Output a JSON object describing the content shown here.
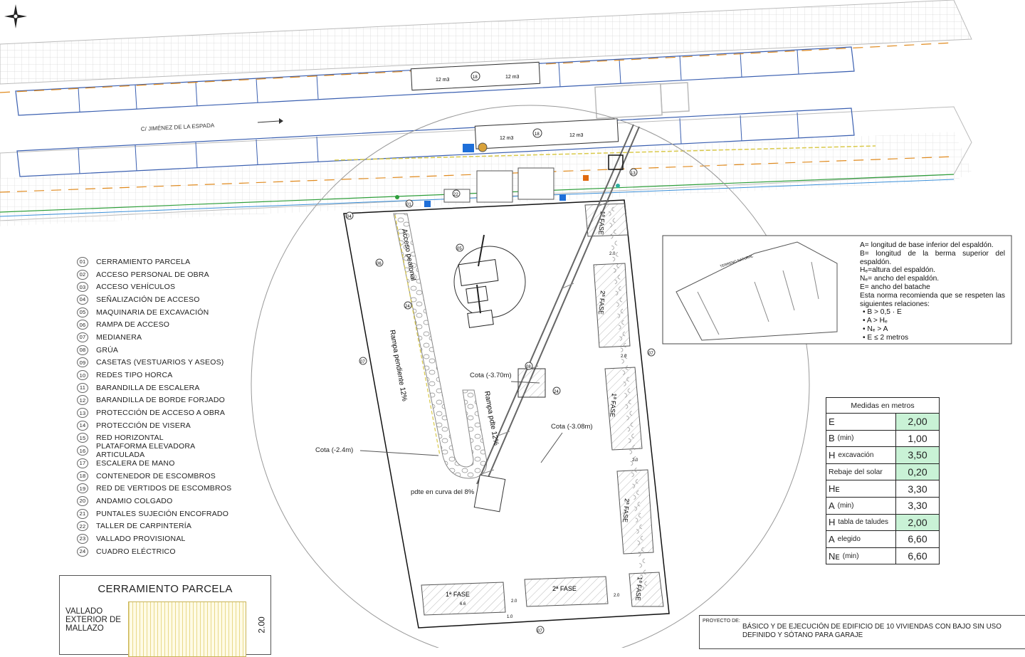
{
  "street": {
    "name": "C/ JIMÉNEZ DE LA ESPADA",
    "container_volume": "12 m3",
    "container_tag": "18"
  },
  "plan_tags": [
    "01",
    "04",
    "05",
    "06",
    "07",
    "08",
    "09",
    "13",
    "22",
    "23",
    "24"
  ],
  "labels": {
    "acceso_peatonal": "Acceso peatonal",
    "rampa_pendiente": "Rampa pendiente 12%",
    "rampa_pdte": "Rampa pdte 12%",
    "cota_1": "Cota (-3.70m)",
    "cota_2": "Cota (-3.08m)",
    "cota_3": "Cota (-2.4m)",
    "pdte_curva": "pdte en curva del 8%",
    "fase_1": "1ª FASE",
    "fase_2": "2ª FASE",
    "dim_20": "2.0",
    "dim_10": "1.0",
    "dim_66": "6.6"
  },
  "legend": [
    {
      "num": "01",
      "label": "CERRAMIENTO PARCELA"
    },
    {
      "num": "02",
      "label": "ACCESO PERSONAL DE OBRA"
    },
    {
      "num": "03",
      "label": "ACCESO VEHÍCULOS"
    },
    {
      "num": "04",
      "label": "SEÑALIZACIÓN DE ACCESO"
    },
    {
      "num": "05",
      "label": "MAQUINARIA DE EXCAVACIÓN"
    },
    {
      "num": "06",
      "label": "RAMPA DE ACCESO"
    },
    {
      "num": "07",
      "label": "MEDIANERA"
    },
    {
      "num": "08",
      "label": "GRÚA"
    },
    {
      "num": "09",
      "label": "CASETAS (VESTUARIOS Y ASEOS)"
    },
    {
      "num": "10",
      "label": "REDES TIPO HORCA"
    },
    {
      "num": "11",
      "label": "BARANDILLA DE ESCALERA"
    },
    {
      "num": "12",
      "label": "BARANDILLA DE BORDE FORJADO"
    },
    {
      "num": "13",
      "label": "PROTECCIÓN DE ACCESO A OBRA"
    },
    {
      "num": "14",
      "label": "PROTECCIÓN DE VISERA"
    },
    {
      "num": "15",
      "label": "RED HORIZONTAL"
    },
    {
      "num": "16",
      "label": "PLATAFORMA ELEVADORA ARTICULADA"
    },
    {
      "num": "17",
      "label": "ESCALERA DE MANO"
    },
    {
      "num": "18",
      "label": "CONTENEDOR DE ESCOMBROS"
    },
    {
      "num": "19",
      "label": "RED DE VERTIDOS DE ESCOMBROS"
    },
    {
      "num": "20",
      "label": "ANDAMIO COLGADO"
    },
    {
      "num": "21",
      "label": "PUNTALES SUJECIÓN ENCOFRADO"
    },
    {
      "num": "22",
      "label": "TALLER DE CARPINTERÍA"
    },
    {
      "num": "23",
      "label": "VALLADO PROVISIONAL"
    },
    {
      "num": "24",
      "label": "CUADRO ELÉCTRICO"
    }
  ],
  "slope_note": {
    "lines": [
      "A= longitud de base inferior del espaldón.",
      "B= longitud de la berma superior del espaldón.",
      "Hₑ=altura del espaldón.",
      "Nₑ= ancho del espaldón.",
      "E= ancho del batache",
      "Esta norma recomienda que se respeten las siguientes relaciones:"
    ],
    "relations": [
      "• B > 0,5 · E",
      "• A > Hₑ",
      "• Nₑ > A",
      "• E ≤  2 metros"
    ],
    "sketch_labels": [
      "TERRENO NATURAL"
    ]
  },
  "measures": {
    "title": "Medidas en metros",
    "rows": [
      {
        "key": "E",
        "sub": "",
        "value": "2,00",
        "hl": true
      },
      {
        "key": "B",
        "sub": "(min)",
        "value": "1,00",
        "hl": false
      },
      {
        "key": "H",
        "sub": "excavación",
        "value": "3,50",
        "hl": true
      },
      {
        "key": "Rebaje del solar",
        "sub": "",
        "value": "0,20",
        "hl": true
      },
      {
        "key": "Hᴇ",
        "sub": "",
        "value": "3,30",
        "hl": false
      },
      {
        "key": "A",
        "sub": "(min)",
        "value": "3,30",
        "hl": false
      },
      {
        "key": "H",
        "sub": "tabla de taludes",
        "value": "2,00",
        "hl": true
      },
      {
        "key": "A",
        "sub": "elegido",
        "value": "6,60",
        "hl": false
      },
      {
        "key": "Nᴇ",
        "sub": "(min)",
        "value": "6,60",
        "hl": false
      }
    ]
  },
  "cerramiento": {
    "title": "CERRAMIENTO PARCELA",
    "label": "VALLADO EXTERIOR DE MALLAZO",
    "dim": "2.00"
  },
  "project": {
    "label": "PROYECTO DE:",
    "value": "BÁSICO Y DE EJECUCIÓN DE EDIFICIO DE 10 VIVIENDAS CON BAJO SIN USO DEFINIDO Y SÓTANO PARA GARAJE"
  },
  "colors": {
    "line_blue": "#3a5fb0",
    "dash_orange": "#e08a1e",
    "fence_yellow": "#d9c94a",
    "service_green": "#2e9e3a",
    "highlight": "#c9f2d6",
    "marker_blue": "#1e6fd9",
    "marker_orange": "#e06a10"
  },
  "icons": [
    "compass-rose-icon",
    "excavator-icon",
    "crane-icon",
    "truck-icon"
  ]
}
